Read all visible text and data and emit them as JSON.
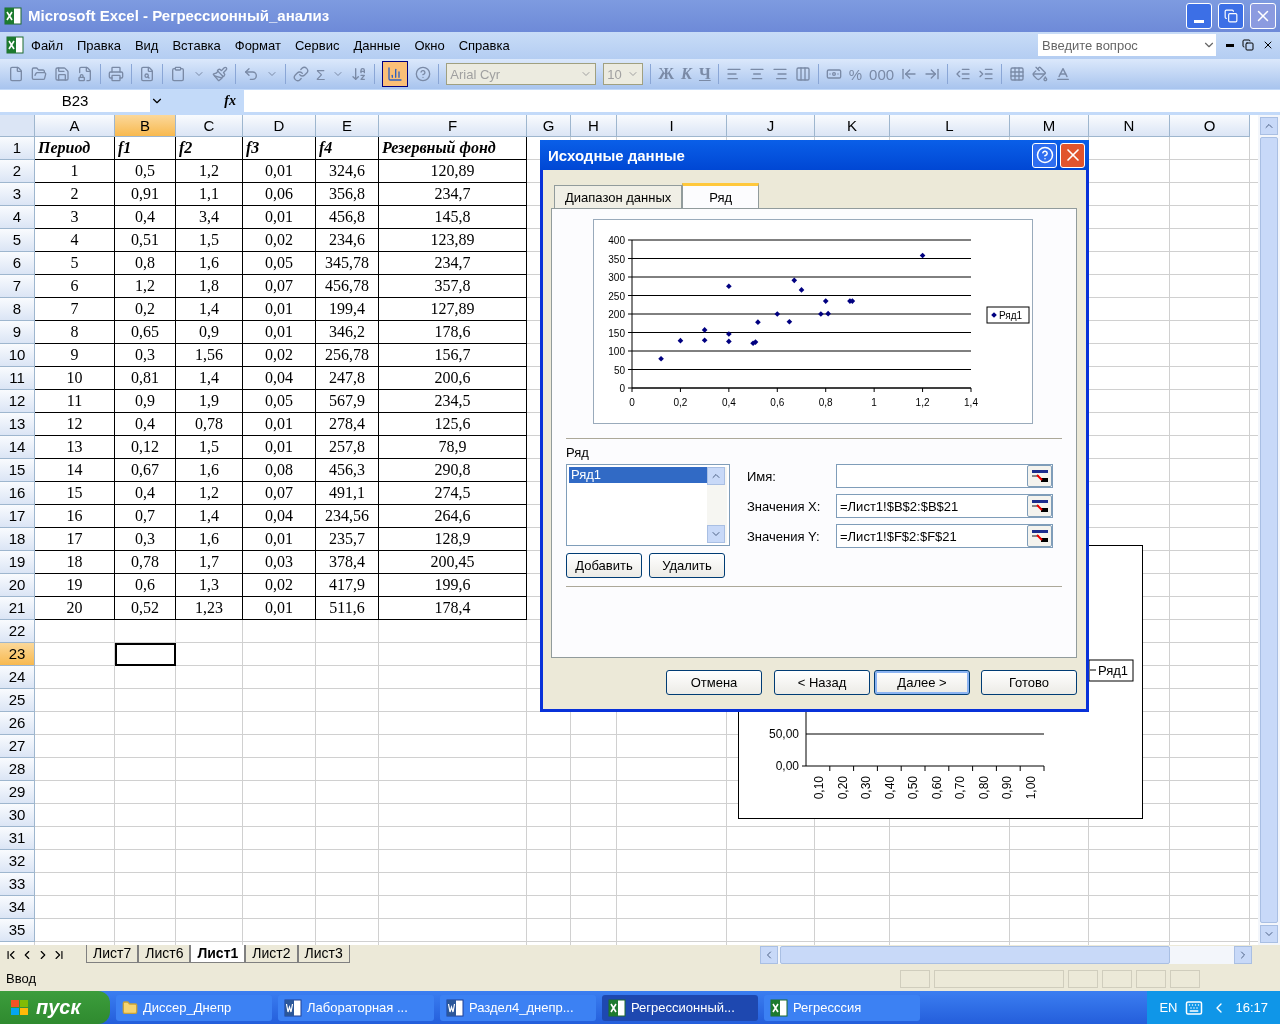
{
  "window": {
    "title": "Microsoft Excel - Регрессионный_анализ"
  },
  "menu": [
    "Файл",
    "Правка",
    "Вид",
    "Вставка",
    "Формат",
    "Сервис",
    "Данные",
    "Окно",
    "Справка"
  ],
  "help_search": {
    "placeholder": "Введите вопрос"
  },
  "toolbar": {
    "sum": "Σ",
    "chart_wizard_pressed": true,
    "font": "Arial Cyr",
    "size": "10",
    "styles": [
      "Ж",
      "К",
      "Ч"
    ],
    "number_formats": [
      "%",
      "000"
    ]
  },
  "formula_bar": {
    "name_box": "B23",
    "fx": "fx"
  },
  "sheet": {
    "columns": [
      {
        "label": "A",
        "selected": false
      },
      {
        "label": "B",
        "selected": true
      },
      {
        "label": "C",
        "selected": false
      },
      {
        "label": "D",
        "selected": false
      },
      {
        "label": "E",
        "selected": false
      },
      {
        "label": "F",
        "selected": false
      },
      {
        "label": "G",
        "selected": false
      },
      {
        "label": "H",
        "selected": false
      },
      {
        "label": "I",
        "selected": false
      },
      {
        "label": "J",
        "selected": false
      },
      {
        "label": "K",
        "selected": false
      },
      {
        "label": "L",
        "selected": false
      },
      {
        "label": "M",
        "selected": false
      },
      {
        "label": "N",
        "selected": false
      },
      {
        "label": "O",
        "selected": false
      }
    ],
    "rows": [
      {
        "number": "1",
        "selected": false,
        "kind": "header",
        "cells": [
          "Период",
          "f1",
          "f2",
          "f3",
          "f4",
          "Резервный фонд"
        ]
      },
      {
        "number": "2",
        "selected": false,
        "kind": "data",
        "cells": [
          "1",
          "0,5",
          "1,2",
          "0,01",
          "324,6",
          "120,89"
        ]
      },
      {
        "number": "3",
        "selected": false,
        "kind": "data",
        "cells": [
          "2",
          "0,91",
          "1,1",
          "0,06",
          "356,8",
          "234,7"
        ]
      },
      {
        "number": "4",
        "selected": false,
        "kind": "data",
        "cells": [
          "3",
          "0,4",
          "3,4",
          "0,01",
          "456,8",
          "145,8"
        ]
      },
      {
        "number": "5",
        "selected": false,
        "kind": "data",
        "cells": [
          "4",
          "0,51",
          "1,5",
          "0,02",
          "234,6",
          "123,89"
        ]
      },
      {
        "number": "6",
        "selected": false,
        "kind": "data",
        "cells": [
          "5",
          "0,8",
          "1,6",
          "0,05",
          "345,78",
          "234,7"
        ]
      },
      {
        "number": "7",
        "selected": false,
        "kind": "data",
        "cells": [
          "6",
          "1,2",
          "1,8",
          "0,07",
          "456,78",
          "357,8"
        ]
      },
      {
        "number": "8",
        "selected": false,
        "kind": "data",
        "cells": [
          "7",
          "0,2",
          "1,4",
          "0,01",
          "199,4",
          "127,89"
        ]
      },
      {
        "number": "9",
        "selected": false,
        "kind": "data",
        "cells": [
          "8",
          "0,65",
          "0,9",
          "0,01",
          "346,2",
          "178,6"
        ]
      },
      {
        "number": "10",
        "selected": false,
        "kind": "data",
        "cells": [
          "9",
          "0,3",
          "1,56",
          "0,02",
          "256,78",
          "156,7"
        ]
      },
      {
        "number": "11",
        "selected": false,
        "kind": "data",
        "cells": [
          "10",
          "0,81",
          "1,4",
          "0,04",
          "247,8",
          "200,6"
        ]
      },
      {
        "number": "12",
        "selected": false,
        "kind": "data",
        "cells": [
          "11",
          "0,9",
          "1,9",
          "0,05",
          "567,9",
          "234,5"
        ]
      },
      {
        "number": "13",
        "selected": false,
        "kind": "data",
        "cells": [
          "12",
          "0,4",
          "0,78",
          "0,01",
          "278,4",
          "125,6"
        ]
      },
      {
        "number": "14",
        "selected": false,
        "kind": "data",
        "cells": [
          "13",
          "0,12",
          "1,5",
          "0,01",
          "257,8",
          "78,9"
        ]
      },
      {
        "number": "15",
        "selected": false,
        "kind": "data",
        "cells": [
          "14",
          "0,67",
          "1,6",
          "0,08",
          "456,3",
          "290,8"
        ]
      },
      {
        "number": "16",
        "selected": false,
        "kind": "data",
        "cells": [
          "15",
          "0,4",
          "1,2",
          "0,07",
          "491,1",
          "274,5"
        ]
      },
      {
        "number": "17",
        "selected": false,
        "kind": "data",
        "cells": [
          "16",
          "0,7",
          "1,4",
          "0,04",
          "234,56",
          "264,6"
        ]
      },
      {
        "number": "18",
        "selected": false,
        "kind": "data",
        "cells": [
          "17",
          "0,3",
          "1,6",
          "0,01",
          "235,7",
          "128,9"
        ]
      },
      {
        "number": "19",
        "selected": false,
        "kind": "data",
        "cells": [
          "18",
          "0,78",
          "1,7",
          "0,03",
          "378,4",
          "200,45"
        ]
      },
      {
        "number": "20",
        "selected": false,
        "kind": "data",
        "cells": [
          "19",
          "0,6",
          "1,3",
          "0,02",
          "417,9",
          "199,6"
        ]
      },
      {
        "number": "21",
        "selected": false,
        "kind": "data",
        "cells": [
          "20",
          "0,52",
          "1,23",
          "0,01",
          "511,6",
          "178,4"
        ]
      },
      {
        "number": "22",
        "selected": false,
        "kind": "empty"
      },
      {
        "number": "23",
        "selected": true,
        "kind": "empty"
      },
      {
        "number": "24",
        "selected": false,
        "kind": "empty"
      },
      {
        "number": "25",
        "selected": false,
        "kind": "empty"
      },
      {
        "number": "26",
        "selected": false,
        "kind": "empty"
      },
      {
        "number": "27",
        "selected": false,
        "kind": "empty"
      },
      {
        "number": "28",
        "selected": false,
        "kind": "empty"
      },
      {
        "number": "29",
        "selected": false,
        "kind": "empty"
      },
      {
        "number": "30",
        "selected": false,
        "kind": "empty"
      },
      {
        "number": "31",
        "selected": false,
        "kind": "empty"
      },
      {
        "number": "32",
        "selected": false,
        "kind": "empty"
      },
      {
        "number": "33",
        "selected": false,
        "kind": "empty"
      },
      {
        "number": "34",
        "selected": false,
        "kind": "empty"
      },
      {
        "number": "35",
        "selected": false,
        "kind": "empty"
      }
    ]
  },
  "background_chart": {
    "legend": "Ряд1",
    "y_tick_labels": [
      "50,00",
      "0,00"
    ],
    "x_tick_labels": [
      "0,10",
      "0,20",
      "0,30",
      "0,40",
      "0,50",
      "0,60",
      "0,70",
      "0,80",
      "0,90",
      "1,00"
    ]
  },
  "dialog": {
    "title": "Исходные данные",
    "tabs": [
      {
        "label": "Диапазон данных",
        "selected": false
      },
      {
        "label": "Ряд",
        "selected": true
      }
    ],
    "chart_data": {
      "type": "scatter",
      "x": [
        0.5,
        0.91,
        0.4,
        0.51,
        0.8,
        1.2,
        0.2,
        0.65,
        0.3,
        0.81,
        0.9,
        0.4,
        0.12,
        0.67,
        0.4,
        0.7,
        0.3,
        0.78,
        0.6,
        0.52
      ],
      "series": [
        {
          "name": "Ряд1",
          "color": "#000080",
          "values": [
            121,
            235,
            146,
            124,
            235,
            358,
            128,
            179,
            157,
            201,
            235,
            126,
            79,
            291,
            275,
            265,
            129,
            200,
            200,
            178
          ]
        }
      ],
      "xlim": [
        0,
        1.4
      ],
      "ylim": [
        0,
        400
      ],
      "grid": true,
      "xticks": [
        0,
        {
          "value": 0.2,
          "label": "0,2"
        },
        {
          "value": 0.4,
          "label": "0,4"
        },
        {
          "value": 0.6,
          "label": "0,6"
        },
        {
          "value": 0.8,
          "label": "0,8"
        },
        1,
        {
          "value": 1.2,
          "label": "1,2"
        },
        {
          "value": 1.4,
          "label": "1,4"
        }
      ],
      "yticks": [
        0,
        50,
        100,
        150,
        200,
        250,
        300,
        350,
        400
      ]
    },
    "series_label": "Ряд",
    "series_list": [
      {
        "label": "Ряд1",
        "selected": true
      }
    ],
    "fields": [
      {
        "label": "Имя:"
      },
      {
        "label": "Значения X:",
        "value": "=Лист1!$B$2:$B$21"
      },
      {
        "label": "Значения Y:",
        "value": "=Лист1!$F$2:$F$21"
      }
    ],
    "series_buttons": [
      "Добавить",
      "Удалить"
    ],
    "buttons": [
      {
        "label": "Отмена",
        "default": false
      },
      {
        "label": "< Назад",
        "default": false
      },
      {
        "label": "Далее >",
        "default": true
      },
      {
        "label": "Готово",
        "default": false
      }
    ]
  },
  "sheet_tabs": [
    {
      "label": "Лист7",
      "selected": false
    },
    {
      "label": "Лист6",
      "selected": false
    },
    {
      "label": "Лист1",
      "selected": true
    },
    {
      "label": "Лист2",
      "selected": false
    },
    {
      "label": "Лист3",
      "selected": false
    }
  ],
  "status_bar": {
    "mode": "Ввод"
  },
  "taskbar": {
    "start": "пуск",
    "tasks": [
      {
        "label": "Диссер_Днепр",
        "kind": "folder",
        "selected": false
      },
      {
        "label": "Лабораторная ...",
        "kind": "word",
        "selected": false
      },
      {
        "label": "Раздел4_днепр...",
        "kind": "word",
        "selected": false
      },
      {
        "label": "Регрессионный...",
        "kind": "excel",
        "selected": true
      },
      {
        "label": "Регресссия",
        "kind": "excel",
        "selected": false
      }
    ],
    "language": "EN",
    "time": "16:17"
  }
}
